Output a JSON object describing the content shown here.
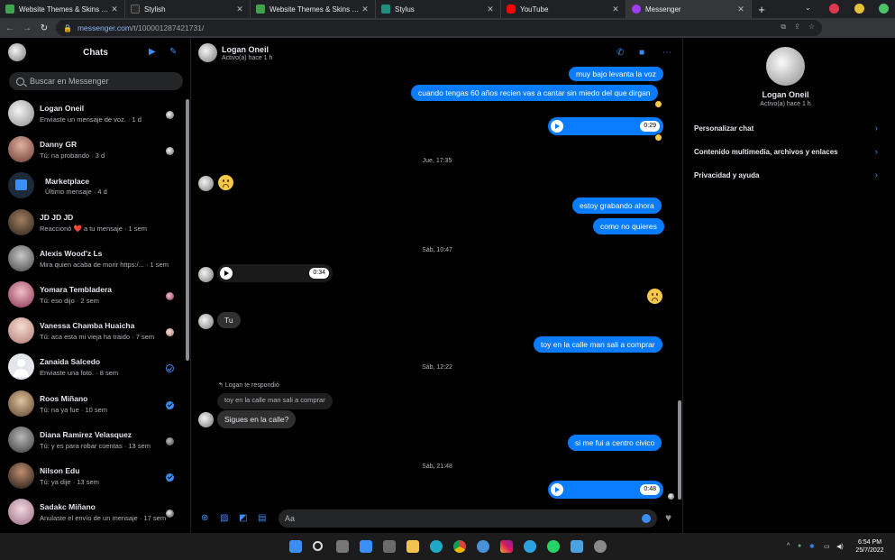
{
  "browser": {
    "tabs": [
      {
        "title": "Website Themes & Skins by Styli",
        "favicon_color": "#3fa34d"
      },
      {
        "title": "Stylish",
        "favicon_color": "#2a2a2a"
      },
      {
        "title": "Website Themes & Skins by Styli",
        "favicon_color": "#3fa34d"
      },
      {
        "title": "Stylus",
        "favicon_color": "#1f8f7f"
      },
      {
        "title": "YouTube",
        "favicon_color": "#ff0000"
      },
      {
        "title": "Messenger",
        "favicon_color": "#a33bff"
      }
    ],
    "url_host": "messenger.com",
    "url_path": "/t/100001287421731/"
  },
  "sidebar": {
    "title": "Chats",
    "search_placeholder": "Buscar en Messenger",
    "conversations": [
      {
        "name": "Logan Oneil",
        "preview": "Enviaste un mensaje de voz. · 1 d",
        "avatar_color": "#cfcfcf",
        "status": "seen"
      },
      {
        "name": "Danny GR",
        "preview": "Tú: na probando · 3 d",
        "avatar_color": "#a86a5a",
        "status": "seen"
      },
      {
        "name": "Marketplace",
        "preview": "Último mensaje · 4 d",
        "avatar_color": "#1d2a3a",
        "status": "none"
      },
      {
        "name": "JD JD JD",
        "preview": "Reaccionó ❤️ a tu mensaje · 1 sem",
        "avatar_color": "#5a4a3a",
        "status": "none"
      },
      {
        "name": "Alexis Wood'z Ls",
        "preview": "Mira quien acaba de morir https:/... · 1 sem",
        "avatar_color": "#7a7a7a",
        "status": "none"
      },
      {
        "name": "Yomara Tembladera",
        "preview": "Tú: eso dijo · 2 sem",
        "avatar_color": "#c25a7a",
        "status": "seen"
      },
      {
        "name": "Vanessa Chamba Huaicha",
        "preview": "Tú: aca esta mi vieja ha traido · 7 sem",
        "avatar_color": "#d9a7a0",
        "status": "seen"
      },
      {
        "name": "Zanaida Salcedo",
        "preview": "Enviaste una foto. · 8 sem",
        "avatar_color": "#e8e8e8",
        "status": "sent"
      },
      {
        "name": "Roos Miñano",
        "preview": "Tú: na ya fue · 10 sem",
        "avatar_color": "#b58f6a",
        "status": "delivered"
      },
      {
        "name": "Diana Ramirez Velasquez",
        "preview": "Tú: y es para robar cuentas · 13 sem",
        "avatar_color": "#8a8a8a",
        "status": "seen"
      },
      {
        "name": "Nilson Edu",
        "preview": "Tú: ya dije · 13 sem",
        "avatar_color": "#5a3a2a",
        "status": "delivered"
      },
      {
        "name": "Sadakc Miñano",
        "preview": "Anulaste el envío de un mensaje · 17 sem",
        "avatar_color": "#d6b0c0",
        "status": "seen"
      }
    ]
  },
  "chat": {
    "name": "Logan Oneil",
    "status": "Activo(a) hace 1 h",
    "messages": {
      "m1": "muy bajo levanta la voz",
      "m2": "cuando tengas 60 años recien vas a cantar sin miedo del que dirgan",
      "audio1": "0:29",
      "stamp1": "Jue, 17:35",
      "m3": "estoy grabando ahora",
      "m4": "como no quieres",
      "stamp2": "Sáb, 10:47",
      "audio2": "0:34",
      "m5": "Tu",
      "m6": "toy en la calle man sali a comprar",
      "stamp3": "Sáb, 12:22",
      "reply_note": "Logan te respondió",
      "reply_quote": "toy en la calle man sali a comprar",
      "m7": "Sigues en la calle?",
      "m8": "si me fui a centro civico",
      "stamp4": "Sáb, 21:48",
      "audio3": "0:48"
    },
    "composer_placeholder": "Aa"
  },
  "info": {
    "name": "Logan Oneil",
    "status": "Activo(a) hace 1 h",
    "items": [
      "Personalizar chat",
      "Contenido multimedia, archivos y enlaces",
      "Privacidad y ayuda"
    ]
  },
  "taskbar": {
    "time": "6:54 PM",
    "date": "25/7/2022"
  },
  "colors": {
    "accent": "#0a7cff",
    "icon_blue": "#3a8ef6"
  }
}
